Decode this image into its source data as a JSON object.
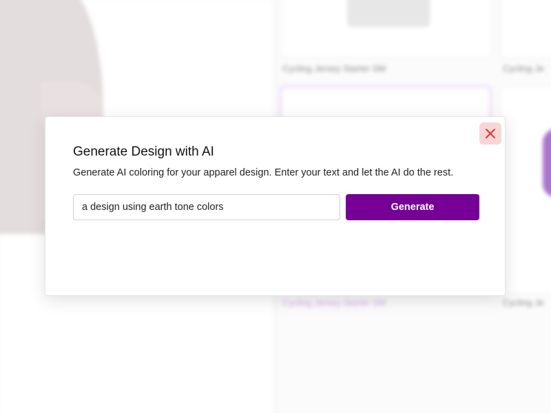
{
  "background": {
    "cards": [
      {
        "label": "Cycling Jersey Starter SM"
      },
      {
        "label": "Cycling Je"
      },
      {
        "label": "Cycling Jersey Starter SM"
      },
      {
        "label": "Cycling Je"
      }
    ]
  },
  "modal": {
    "title": "Generate Design with AI",
    "description": "Generate AI coloring for your apparel design. Enter your text and let the AI do the rest.",
    "prompt_value": "a design using earth tone colors",
    "generate_label": "Generate",
    "close_icon": "close-icon"
  },
  "colors": {
    "accent": "#760096",
    "close_bg": "#f9d6d6",
    "close_icon": "#d33b3b"
  }
}
